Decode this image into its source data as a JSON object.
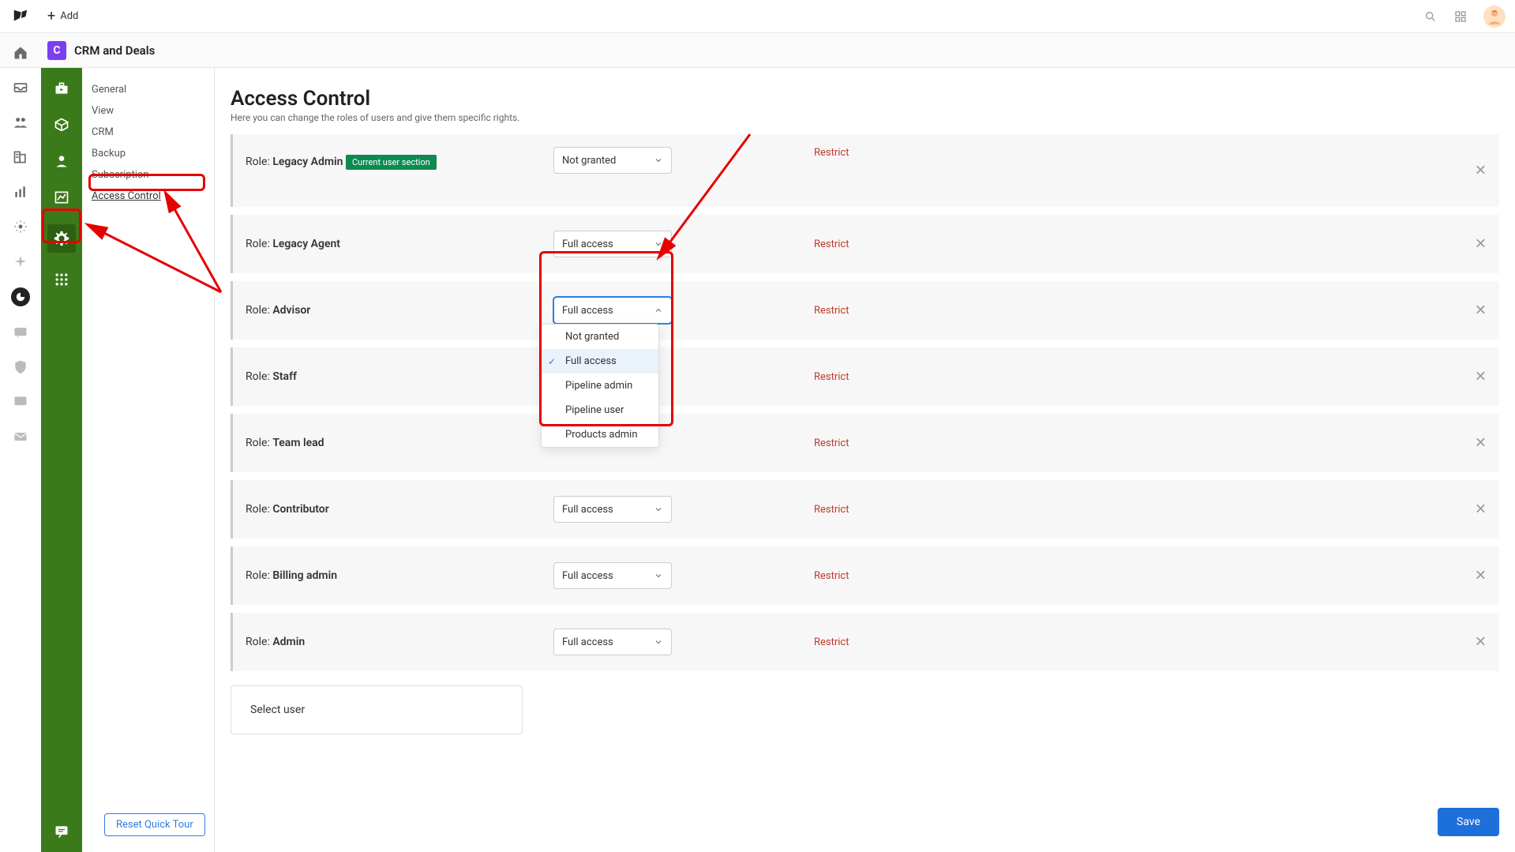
{
  "topbar": {
    "add_label": "Add"
  },
  "app": {
    "title": "CRM and Deals",
    "icon_letter": "C"
  },
  "settings_nav": {
    "items": [
      "General",
      "View",
      "CRM",
      "Backup",
      "Subscription",
      "Access Control"
    ],
    "active_index": 5,
    "reset_tour": "Reset Quick Tour"
  },
  "page": {
    "title": "Access Control",
    "subtitle": "Here you can change the roles of users and give them specific rights.",
    "restrict_label": "Restrict",
    "role_prefix": "Role: ",
    "current_user_badge": "Current user section",
    "select_user": "Select user",
    "save": "Save"
  },
  "roles": [
    {
      "name": "Legacy Admin",
      "access": "Not granted",
      "badge": true
    },
    {
      "name": "Legacy Agent",
      "access": "Full access"
    },
    {
      "name": "Advisor",
      "access": "Full access",
      "open": true
    },
    {
      "name": "Staff",
      "access": ""
    },
    {
      "name": "Team lead",
      "access": ""
    },
    {
      "name": "Contributor",
      "access": "Full access"
    },
    {
      "name": "Billing admin",
      "access": "Full access"
    },
    {
      "name": "Admin",
      "access": "Full access"
    }
  ],
  "dropdown_options": [
    "Not granted",
    "Full access",
    "Pipeline admin",
    "Pipeline user",
    "Products admin"
  ],
  "dropdown_selected": "Full access"
}
